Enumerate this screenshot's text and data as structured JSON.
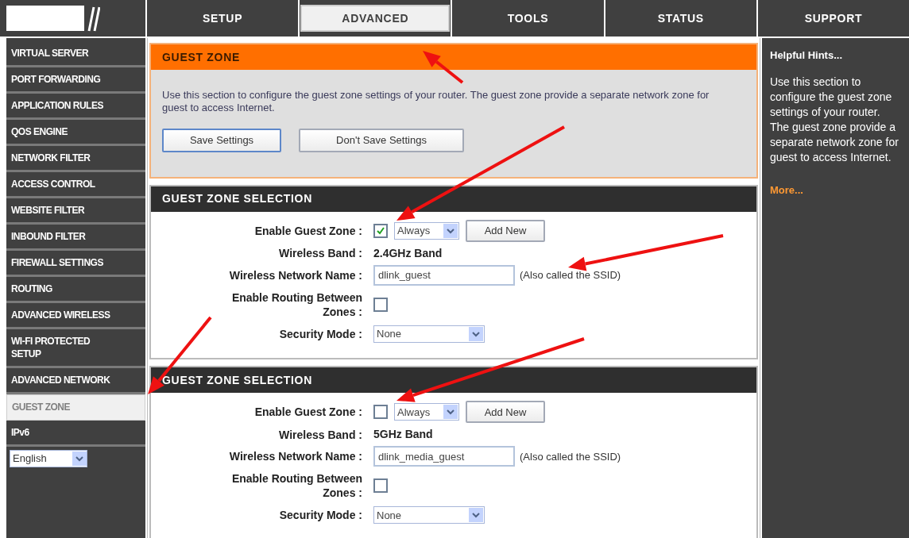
{
  "tabs": [
    {
      "label": "SETUP",
      "selected": false
    },
    {
      "label": "ADVANCED",
      "selected": true
    },
    {
      "label": "TOOLS",
      "selected": false
    },
    {
      "label": "STATUS",
      "selected": false
    },
    {
      "label": "SUPPORT",
      "selected": false
    }
  ],
  "sidebar": {
    "items": [
      {
        "label": "VIRTUAL SERVER",
        "selected": false
      },
      {
        "label": "PORT FORWARDING",
        "selected": false
      },
      {
        "label": "APPLICATION RULES",
        "selected": false
      },
      {
        "label": "QOS ENGINE",
        "selected": false
      },
      {
        "label": "NETWORK FILTER",
        "selected": false
      },
      {
        "label": "ACCESS CONTROL",
        "selected": false
      },
      {
        "label": "WEBSITE FILTER",
        "selected": false
      },
      {
        "label": "INBOUND FILTER",
        "selected": false
      },
      {
        "label": "FIREWALL SETTINGS",
        "selected": false
      },
      {
        "label": "ROUTING",
        "selected": false
      },
      {
        "label": "ADVANCED WIRELESS",
        "selected": false
      },
      {
        "label": "WI-FI PROTECTED SETUP",
        "selected": false
      },
      {
        "label": "ADVANCED NETWORK",
        "selected": false
      },
      {
        "label": "GUEST ZONE",
        "selected": true
      },
      {
        "label": "IPv6",
        "selected": false
      }
    ],
    "language": "English"
  },
  "intro": {
    "title": "GUEST ZONE",
    "text": "Use this section to configure the guest zone settings of your router. The guest zone provide a separate network zone for guest to access Internet.",
    "buttons": [
      "Save Settings",
      "Don't Save Settings"
    ]
  },
  "sections": [
    {
      "title": "GUEST ZONE SELECTION",
      "enable_label": "Enable Guest Zone :",
      "enabled": true,
      "schedule": "Always",
      "add_button": "Add New",
      "band_label": "Wireless Band :",
      "band": "2.4GHz Band",
      "name_label": "Wireless Network Name :",
      "ssid": "dlink_guest",
      "ssid_note": "(Also called the SSID)",
      "routing_label": "Enable Routing Between Zones :",
      "routing": false,
      "security_label": "Security Mode :",
      "security": "None"
    },
    {
      "title": "GUEST ZONE SELECTION",
      "enable_label": "Enable Guest Zone :",
      "enabled": false,
      "schedule": "Always",
      "add_button": "Add New",
      "band_label": "Wireless Band :",
      "band": "5GHz Band",
      "name_label": "Wireless Network Name :",
      "ssid": "dlink_media_guest",
      "ssid_note": "(Also called the SSID)",
      "routing_label": "Enable Routing Between Zones :",
      "routing": false,
      "security_label": "Security Mode :",
      "security": "None"
    }
  ],
  "hints": {
    "title": "Helpful Hints...",
    "text": "Use this section to configure the guest zone settings of your router. The guest zone provide a separate network zone for guest to access Internet.",
    "more": "More..."
  }
}
